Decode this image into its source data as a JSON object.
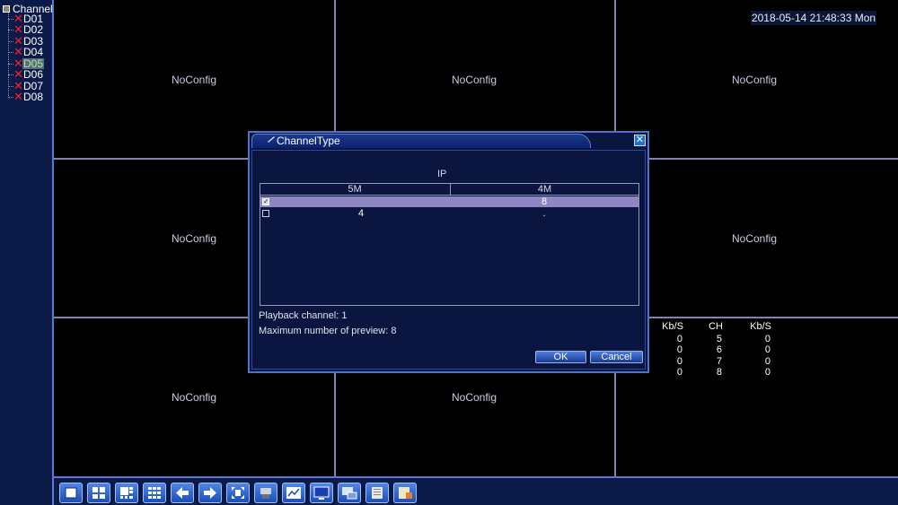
{
  "sidebar": {
    "root_label": "Channel",
    "channels": [
      {
        "label": "D01",
        "selected": false
      },
      {
        "label": "D02",
        "selected": false
      },
      {
        "label": "D03",
        "selected": false
      },
      {
        "label": "D04",
        "selected": false
      },
      {
        "label": "D05",
        "selected": true
      },
      {
        "label": "D06",
        "selected": false
      },
      {
        "label": "D07",
        "selected": false
      },
      {
        "label": "D08",
        "selected": false
      }
    ]
  },
  "datetime": "2018-05-14 21:48:33 Mon",
  "grid": {
    "cell_label": "NoConfig",
    "cells": [
      "NoConfig",
      "NoConfig",
      "NoConfig",
      "NoConfig",
      "NoConfig",
      "NoConfig",
      "NoConfig",
      "NoConfig"
    ]
  },
  "stats": {
    "headers": [
      "Kb/S",
      "CH",
      "Kb/S"
    ],
    "rows": [
      {
        "kb1": "0",
        "ch": "5",
        "kb2": "0"
      },
      {
        "kb1": "0",
        "ch": "6",
        "kb2": "0"
      },
      {
        "kb1": "0",
        "ch": "7",
        "kb2": "0"
      },
      {
        "kb1": "0",
        "ch": "8",
        "kb2": "0"
      }
    ]
  },
  "dialog": {
    "title": "ChannelType",
    "close_glyph": "✕",
    "group_header": "IP",
    "columns": [
      "5M",
      "4M"
    ],
    "rows": [
      {
        "checked": true,
        "col1": "",
        "col2": "8",
        "selected": true
      },
      {
        "checked": false,
        "col1": "4",
        "col2": ".",
        "selected": false
      }
    ],
    "playback": "Playback channel: 1",
    "max_preview": "Maximum number of preview: 8",
    "ok_label": "OK",
    "cancel_label": "Cancel"
  },
  "toolbar": {
    "buttons": [
      "single-view-icon",
      "quad-view-icon",
      "eight-view-icon",
      "nine-view-icon",
      "previous-icon",
      "next-icon",
      "fullscreen-icon",
      "ptz-icon",
      "chart-icon",
      "monitor-icon",
      "network-icon",
      "record-icon",
      "logout-icon"
    ]
  },
  "colors": {
    "panel_bg": "#0c1a4a",
    "accent_border": "#5a7ad0",
    "grid_line": "#8a7fb0",
    "selected_row": "#8f86c4",
    "error_mark": "#ff2020"
  }
}
